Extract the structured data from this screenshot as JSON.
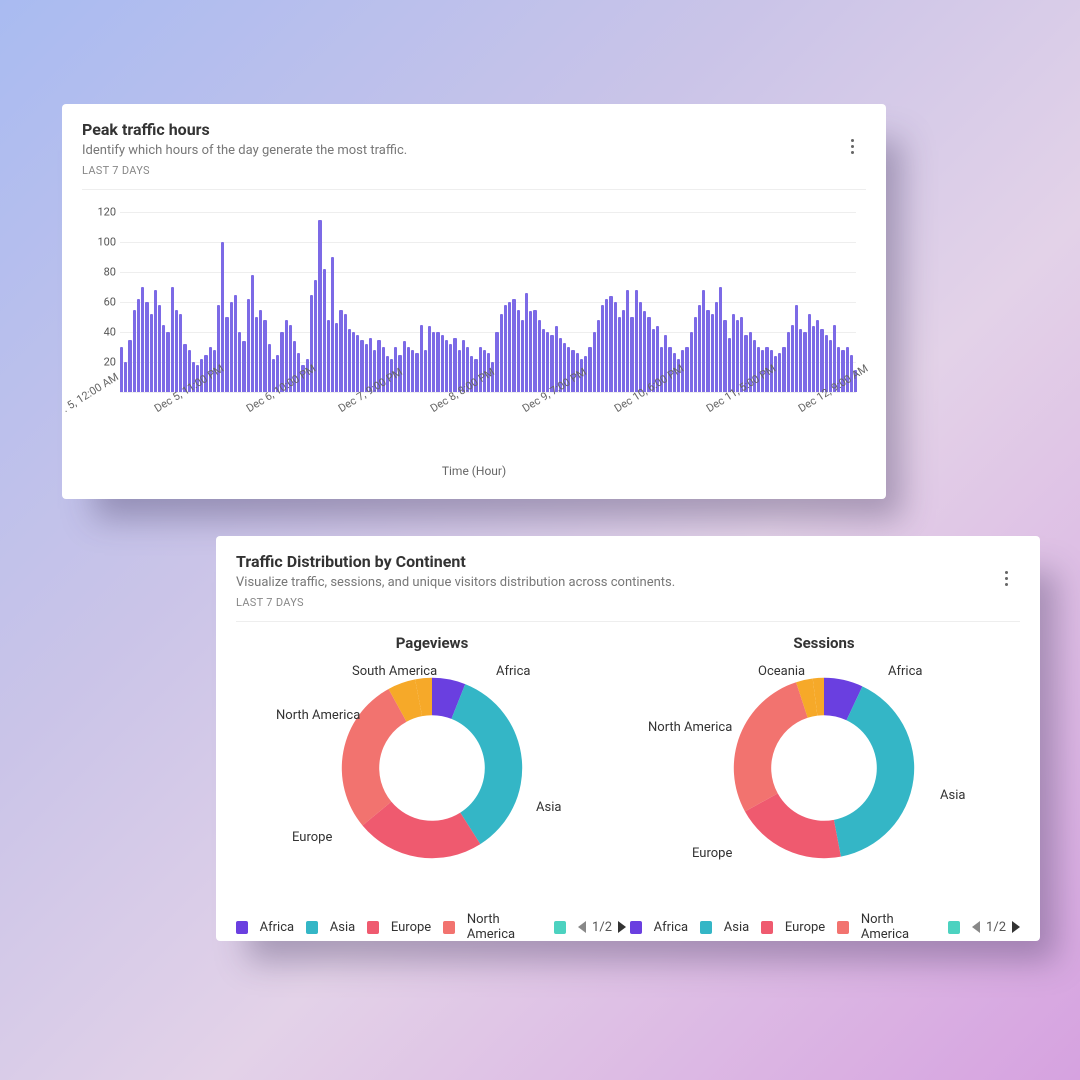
{
  "card1": {
    "title": "Peak traffic hours",
    "sub": "Identify which hours of the day generate the most traffic.",
    "range": "LAST 7 DAYS"
  },
  "card2": {
    "title": "Traffic Distribution by Continent",
    "sub": "Visualize traffic, sessions, and unique visitors distribution across continents.",
    "range": "LAST 7 DAYS"
  },
  "donut_titles": {
    "pageviews": "Pageviews",
    "sessions": "Sessions"
  },
  "donut_labels": {
    "africa": "Africa",
    "asia": "Asia",
    "europe": "Europe",
    "na": "North America",
    "sa": "South America",
    "oc": "Oceania"
  },
  "legend": {
    "africa": "Africa",
    "asia": "Asia",
    "europe": "Europe",
    "na": "North America",
    "page": "1/2"
  },
  "colors": {
    "bar": "#7c6ae6",
    "africa": "#6a3fe0",
    "asia": "#34b6c6",
    "europe": "#ef5a6f",
    "na": "#f2736f",
    "sa": "#f6a929",
    "oc": "#f6a929",
    "extra": "#4cd2c0"
  },
  "chart_data": [
    {
      "type": "bar",
      "title": "Peak traffic hours",
      "xlabel": "Time (Hour)",
      "ylabel": "",
      "ylim": [
        0,
        120
      ],
      "y_ticks": [
        20,
        40,
        60,
        80,
        100,
        120
      ],
      "x_ticks": [
        ". 5, 12:00 AM",
        "Dec 5, 11:00 PM",
        "Dec 6, 10:00 PM",
        "Dec 7, 9:00 PM",
        "Dec 8, 8:00 PM",
        "Dec 9, 7:00 PM",
        "Dec 10, 6:00 PM",
        "Dec 11, 5:00 PM",
        "Dec 12, 9:00 AM"
      ],
      "values": [
        30,
        20,
        35,
        55,
        62,
        70,
        60,
        52,
        68,
        58,
        45,
        40,
        70,
        55,
        52,
        32,
        28,
        20,
        18,
        22,
        25,
        30,
        28,
        58,
        100,
        50,
        60,
        65,
        40,
        34,
        62,
        78,
        50,
        55,
        48,
        32,
        22,
        25,
        40,
        48,
        45,
        34,
        26,
        18,
        22,
        65,
        75,
        115,
        82,
        48,
        90,
        46,
        55,
        52,
        42,
        40,
        38,
        35,
        32,
        36,
        28,
        35,
        30,
        24,
        22,
        30,
        25,
        34,
        30,
        28,
        26,
        45,
        28,
        44,
        40,
        40,
        38,
        35,
        32,
        36,
        28,
        35,
        30,
        24,
        22,
        30,
        28,
        26,
        20,
        40,
        52,
        58,
        60,
        62,
        55,
        48,
        66,
        54,
        55,
        48,
        42,
        40,
        38,
        44,
        36,
        33,
        30,
        28,
        26,
        22,
        24,
        30,
        40,
        48,
        58,
        62,
        64,
        60,
        50,
        55,
        68,
        50,
        68,
        60,
        54,
        50,
        42,
        44,
        30,
        38,
        30,
        26,
        22,
        28,
        30,
        40,
        50,
        58,
        68,
        55,
        52,
        60,
        70,
        48,
        36,
        52,
        48,
        50,
        38,
        40,
        35,
        30,
        28,
        30,
        28,
        24,
        26,
        30,
        40,
        45,
        58,
        42,
        40,
        52,
        44,
        48,
        42,
        38,
        35,
        45,
        30,
        28,
        30,
        25,
        15
      ]
    },
    {
      "type": "pie",
      "title": "Pageviews",
      "series": [
        {
          "name": "Africa",
          "value": 6
        },
        {
          "name": "Asia",
          "value": 35
        },
        {
          "name": "Europe",
          "value": 23
        },
        {
          "name": "North America",
          "value": 28
        },
        {
          "name": "South America",
          "value": 5
        },
        {
          "name": "Oceania",
          "value": 3
        }
      ]
    },
    {
      "type": "pie",
      "title": "Sessions",
      "series": [
        {
          "name": "Africa",
          "value": 7
        },
        {
          "name": "Asia",
          "value": 40
        },
        {
          "name": "Europe",
          "value": 20
        },
        {
          "name": "North America",
          "value": 28
        },
        {
          "name": "Oceania",
          "value": 3
        },
        {
          "name": "South America",
          "value": 2
        }
      ]
    }
  ]
}
